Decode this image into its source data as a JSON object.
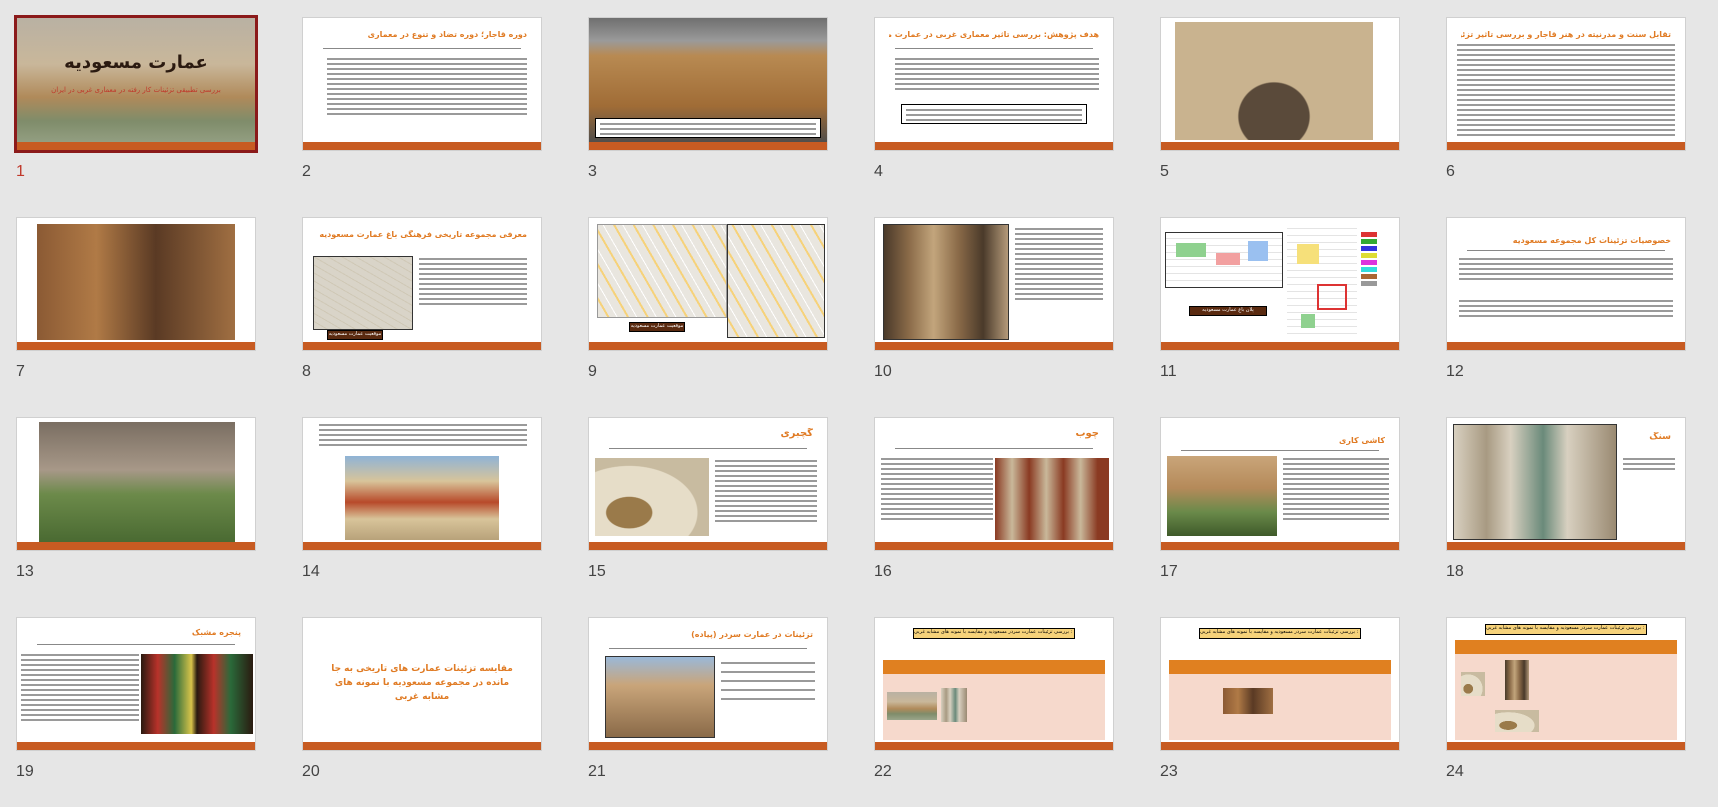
{
  "slides": {
    "s1": {
      "number": "1",
      "title": "عمارت مسعودیه",
      "subtitle": "بررسی تطبیقی تزئینات کار رفته در معماری غربی در ایران"
    },
    "s2": {
      "number": "2",
      "title": "دوره قاجار؛ دوره تضاد و تنوع در معماری"
    },
    "s3": {
      "number": "3"
    },
    "s4": {
      "number": "4",
      "title": "هدف پژوهش: بررسی تاثیر معماری غربی در عمارت مسعودیه"
    },
    "s5": {
      "number": "5"
    },
    "s6": {
      "number": "6",
      "title": "تقابل سنت و مدرنیته در هنر قاجار و بررسی تاثیر تزئینی غربی در مسعودیه"
    },
    "s7": {
      "number": "7"
    },
    "s8": {
      "number": "8",
      "title": "معرفی مجموعه تاریخی فرهنگی باغ عمارت مسعودیه",
      "caption": "موقعیت عمارت مسعودیه"
    },
    "s9": {
      "number": "9",
      "caption": "موقعیت عمارت مسعودیه"
    },
    "s10": {
      "number": "10"
    },
    "s11": {
      "number": "11",
      "caption": "پلان باغ عمارت مسعودیه"
    },
    "s12": {
      "number": "12",
      "title": "خصوصیات تزئینات کل مجموعه مسعودیه"
    },
    "s13": {
      "number": "13"
    },
    "s14": {
      "number": "14"
    },
    "s15": {
      "number": "15",
      "title": "گچبری"
    },
    "s16": {
      "number": "16",
      "title": "چوب"
    },
    "s17": {
      "number": "17",
      "title": "کاشی کاری"
    },
    "s18": {
      "number": "18",
      "title": "سنگ"
    },
    "s19": {
      "number": "19",
      "title": "پنجره مشبک"
    },
    "s20": {
      "number": "20",
      "title": "مقایسه تزئینات عمارت های تاریخی به جا مانده در مجموعه مسعودیه با نمونه های مشابه غربی"
    },
    "s21": {
      "number": "21",
      "title": "تزئینات در عمارت سردر (پیاده)"
    },
    "s22": {
      "number": "22",
      "caption": "جدول یک : بررسی تزئینات عمارت سردر مسعودیه و مقایسه با نمونه های مشابه غربی"
    },
    "s23": {
      "number": "23",
      "caption": "جدول یک : بررسی تزئینات عمارت سردر مسعودیه و مقایسه با نمونه های مشابه غربی"
    },
    "s24": {
      "number": "24",
      "caption": "جدول یک : بررسی تزئینات عمارت سردر مسعودیه و مقایسه با نمونه های مشابه غربی"
    }
  },
  "selected_slide": "1",
  "colors": {
    "accent_bar": "#c75b22",
    "title_orange": "#e07b24",
    "selection_border": "#8b1a1a",
    "table_header": "#e08020",
    "table_body": "#f6d9cc"
  }
}
